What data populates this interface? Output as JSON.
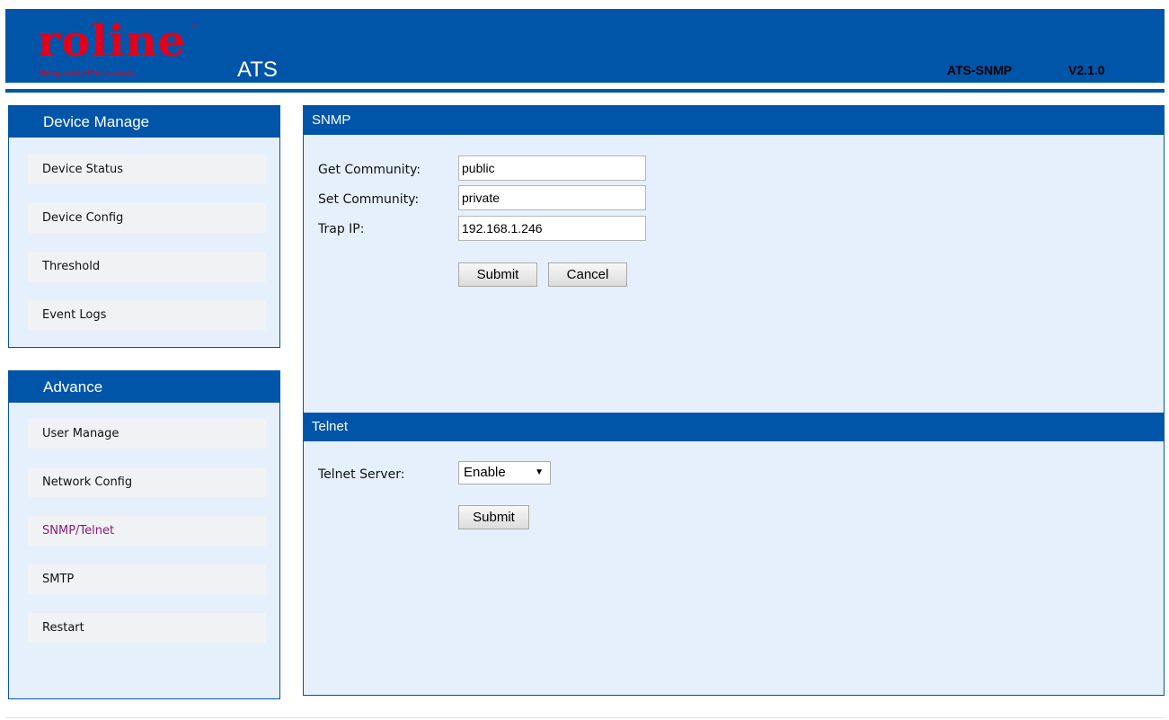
{
  "header": {
    "logo_word": "roline",
    "logo_registered": "®",
    "logo_tagline": "Designed for Professionals",
    "app_title": "ATS",
    "product_name": "ATS-SNMP",
    "version": "V2.1.0"
  },
  "sidebar": {
    "device_manage": {
      "title": "Device Manage",
      "items": [
        {
          "label": "Device Status"
        },
        {
          "label": "Device Config"
        },
        {
          "label": "Threshold"
        },
        {
          "label": "Event Logs"
        }
      ]
    },
    "advance": {
      "title": "Advance",
      "items": [
        {
          "label": "User Manage"
        },
        {
          "label": "Network Config"
        },
        {
          "label": "SNMP/Telnet",
          "active": true
        },
        {
          "label": "SMTP"
        },
        {
          "label": "Restart"
        }
      ]
    }
  },
  "snmp": {
    "title": "SNMP",
    "get_community_label": "Get Community:",
    "get_community_value": "public",
    "set_community_label": "Set Community:",
    "set_community_value": "private",
    "trap_ip_label": "Trap IP:",
    "trap_ip_value": "192.168.1.246",
    "submit_label": "Submit",
    "cancel_label": "Cancel"
  },
  "telnet": {
    "title": "Telnet",
    "server_label": "Telnet Server:",
    "server_value": "Enable",
    "submit_label": "Submit"
  },
  "colors": {
    "brand_blue": "#0055a8",
    "logo_red": "#e2001a",
    "panel_bg": "#e6f0fc",
    "active_item": "#8b1a7a"
  }
}
